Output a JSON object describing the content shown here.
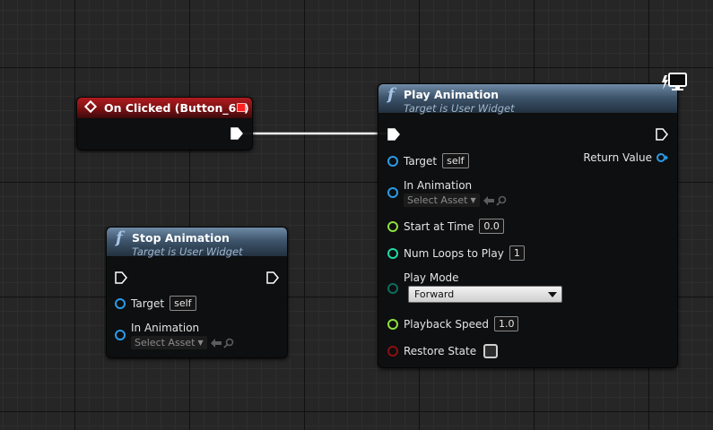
{
  "colors": {
    "exec_pin": "#ffffff",
    "object_pin": "#2b9be8",
    "float_pin": "#8de03e",
    "int_pin": "#1fd8a6",
    "byte_pin": "#0e6b5f",
    "bool_pin": "#8c0f0f",
    "event_header": "#b01b1f",
    "function_header": "#5d7994"
  },
  "event_node": {
    "title": "On Clicked (Button_62)",
    "icon": "event-diamond-icon"
  },
  "play_node": {
    "title": "Play Animation",
    "subtitle": "Target is User Widget",
    "icon": "function-icon",
    "target_label": "Target",
    "target_value": "self",
    "return_label": "Return Value",
    "in_anim_label": "In Animation",
    "in_anim_value": "Select Asset",
    "start_time_label": "Start at Time",
    "start_time_value": "0.0",
    "num_loops_label": "Num Loops to Play",
    "num_loops_value": "1",
    "play_mode_label": "Play Mode",
    "play_mode_value": "Forward",
    "speed_label": "Playback Speed",
    "speed_value": "1.0",
    "restore_label": "Restore State",
    "restore_checked": false
  },
  "stop_node": {
    "title": "Stop Animation",
    "subtitle": "Target is User Widget",
    "icon": "function-icon",
    "target_label": "Target",
    "target_value": "self",
    "in_anim_label": "In Animation",
    "in_anim_value": "Select Asset"
  },
  "indicators": {
    "server_icon": "network-server-icon"
  }
}
